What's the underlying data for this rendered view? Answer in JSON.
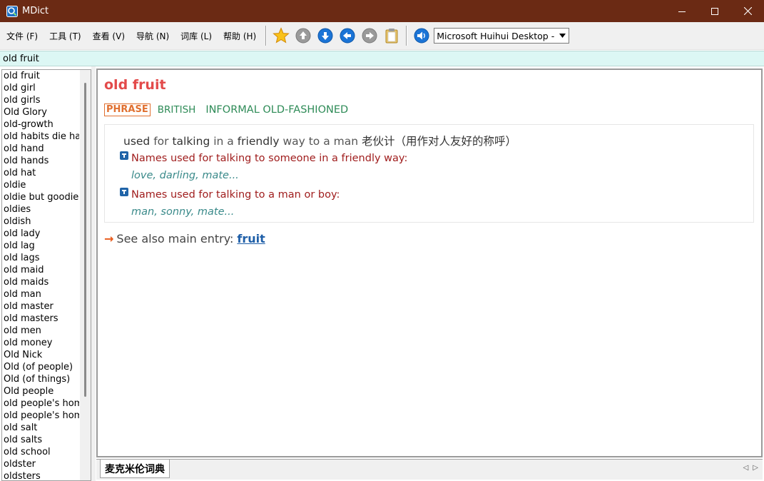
{
  "window": {
    "title": "MDict",
    "controls": {
      "minimize": "—",
      "maximize": "☐",
      "close": "✕"
    }
  },
  "menu": [
    {
      "id": "file",
      "label": "文件 (F)"
    },
    {
      "id": "tools",
      "label": "工具 (T)"
    },
    {
      "id": "view",
      "label": "查看 (V)"
    },
    {
      "id": "navigate",
      "label": "导航 (N)"
    },
    {
      "id": "library",
      "label": "词库 (L)"
    },
    {
      "id": "help",
      "label": "帮助 (H)"
    }
  ],
  "toolbar": {
    "icons": [
      "star-icon",
      "arrow-up-icon",
      "arrow-down-icon",
      "arrow-left-icon",
      "arrow-right-icon",
      "clipboard-icon",
      "speaker-icon"
    ],
    "font_select_value": "Microsoft Huihui Desktop - Chinese (Simplified)"
  },
  "search": {
    "value": "old fruit"
  },
  "wordlist": [
    "old fruit",
    "old girl",
    "old girls",
    "Old Glory",
    "old-growth",
    "old habits die hard",
    "old hand",
    "old hands",
    "old hat",
    "oldie",
    "oldie but goodie",
    "oldies",
    "oldish",
    "old lady",
    "old lag",
    "old lags",
    "old maid",
    "old maids",
    "old man",
    "old master",
    "old masters",
    "old men",
    "old money",
    "Old Nick",
    "Old (of people)",
    "Old (of things)",
    "Old people",
    "old people's home",
    "old people's homes",
    "old salt",
    "old salts",
    "old school",
    "oldster",
    "oldsters"
  ],
  "entry": {
    "headword": "old fruit",
    "pos_tag": "PHRASE",
    "region": "BRITISH",
    "register": "INFORMAL OLD-FASHIONED",
    "definition": {
      "w1": "used",
      "w2": " for ",
      "w3": "talking",
      "w4": " in a ",
      "w5": "friendly",
      "w6": " way to a man ",
      "translation": "老伙计（用作对人友好的称呼）"
    },
    "subsenses": [
      {
        "definition": "Names used for talking to someone in a friendly way:",
        "examples": "love, darling, mate..."
      },
      {
        "definition": "Names used for talking to a man or boy:",
        "examples": "man, sonny, mate..."
      }
    ],
    "see_also": {
      "arrow": "→",
      "label": "See also main entry:",
      "link": "fruit"
    }
  },
  "tabs": [
    {
      "label": "麦克米伦词典"
    }
  ],
  "tab_nav": {
    "prev": "◁",
    "next": "▷"
  },
  "colors": {
    "titlebar": "#6b2a14",
    "search_bg": "#dcf7f4",
    "headword": "#e34a4a",
    "phrase_tag": "#e07030",
    "region_tag": "#2e8b57",
    "subsense_text": "#a01e1e",
    "example_text": "#3a8a8a",
    "link": "#1f5fa8"
  }
}
